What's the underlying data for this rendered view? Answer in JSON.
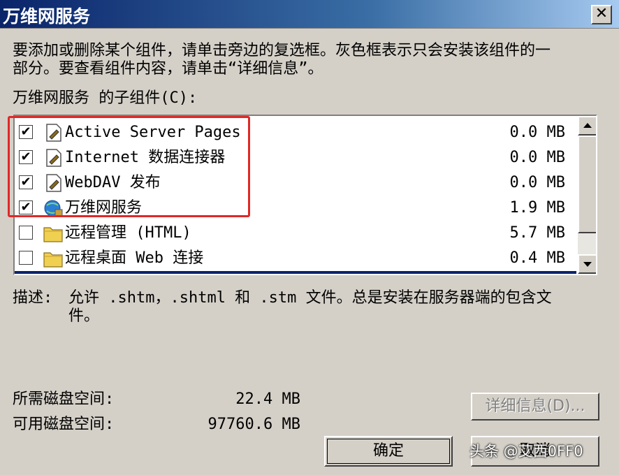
{
  "window": {
    "title": "万维网服务",
    "close_glyph": "✕"
  },
  "instructions": {
    "line1": "要添加或删除某个组件，请单击旁边的复选框。灰色框表示只会安装该组件的一",
    "line2": "部分。要查看组件内容，请单击“详细信息”。"
  },
  "list": {
    "label": "万维网服务 的子组件(C):",
    "items": [
      {
        "label": "Active Server Pages",
        "size": "0.0 MB",
        "checked": true,
        "icon": "component-icon"
      },
      {
        "label": "Internet 数据连接器",
        "size": "0.0 MB",
        "checked": true,
        "icon": "component-icon"
      },
      {
        "label": "WebDAV 发布",
        "size": "0.0 MB",
        "checked": true,
        "icon": "component-icon"
      },
      {
        "label": "万维网服务",
        "size": "1.9 MB",
        "checked": true,
        "icon": "web-service-icon"
      },
      {
        "label": "远程管理 (HTML)",
        "size": "5.7 MB",
        "checked": false,
        "icon": "folder-icon"
      },
      {
        "label": "远程桌面 Web 连接",
        "size": "0.4 MB",
        "checked": false,
        "icon": "folder-icon"
      }
    ],
    "checkmark": "✔"
  },
  "description": {
    "label": "描述:",
    "line1": "允许 .shtm，.shtml 和 .stm 文件。总是安装在服务器端的包含文",
    "line2": "件。"
  },
  "disk": {
    "required_label": "所需磁盘空间:",
    "required_value": "22.4 MB",
    "available_label": "可用磁盘空间:",
    "available_value": "97760.6 MB"
  },
  "buttons": {
    "details": "详细信息(D)...",
    "ok": "确定",
    "cancel": "取消"
  },
  "watermark": "头条 @艾西0FF0",
  "colors": {
    "selection": "#0a246a",
    "highlight_box": "#e02828",
    "dialog_bg": "#d4d0c8"
  }
}
